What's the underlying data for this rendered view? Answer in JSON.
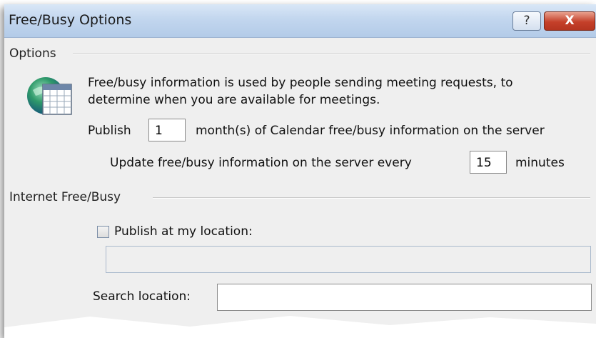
{
  "window": {
    "title": "Free/Busy Options",
    "help_label": "?",
    "close_label": "X"
  },
  "options_group": {
    "label": "Options",
    "description_line1": "Free/busy information is used by people sending meeting requests, to",
    "description_line2": "determine when you are available for meetings.",
    "publish_prefix": "Publish",
    "publish_months_value": "1",
    "publish_suffix": "month(s) of Calendar free/busy information on the server",
    "update_prefix": "Update free/busy information on the server every",
    "update_minutes_value": "15",
    "update_suffix": "minutes"
  },
  "internet_group": {
    "label": "Internet Free/Busy",
    "publish_checkbox_label": "Publish at my location:",
    "publish_checked": false,
    "publish_location_value": "",
    "search_location_label": "Search location:",
    "search_location_value": ""
  },
  "colors": {
    "titlebar": "#c2d6ee",
    "dialog_background": "#efefef",
    "close_button": "#c5402a"
  },
  "icons": [
    "calendar-globe-icon",
    "help-icon",
    "close-icon"
  ]
}
